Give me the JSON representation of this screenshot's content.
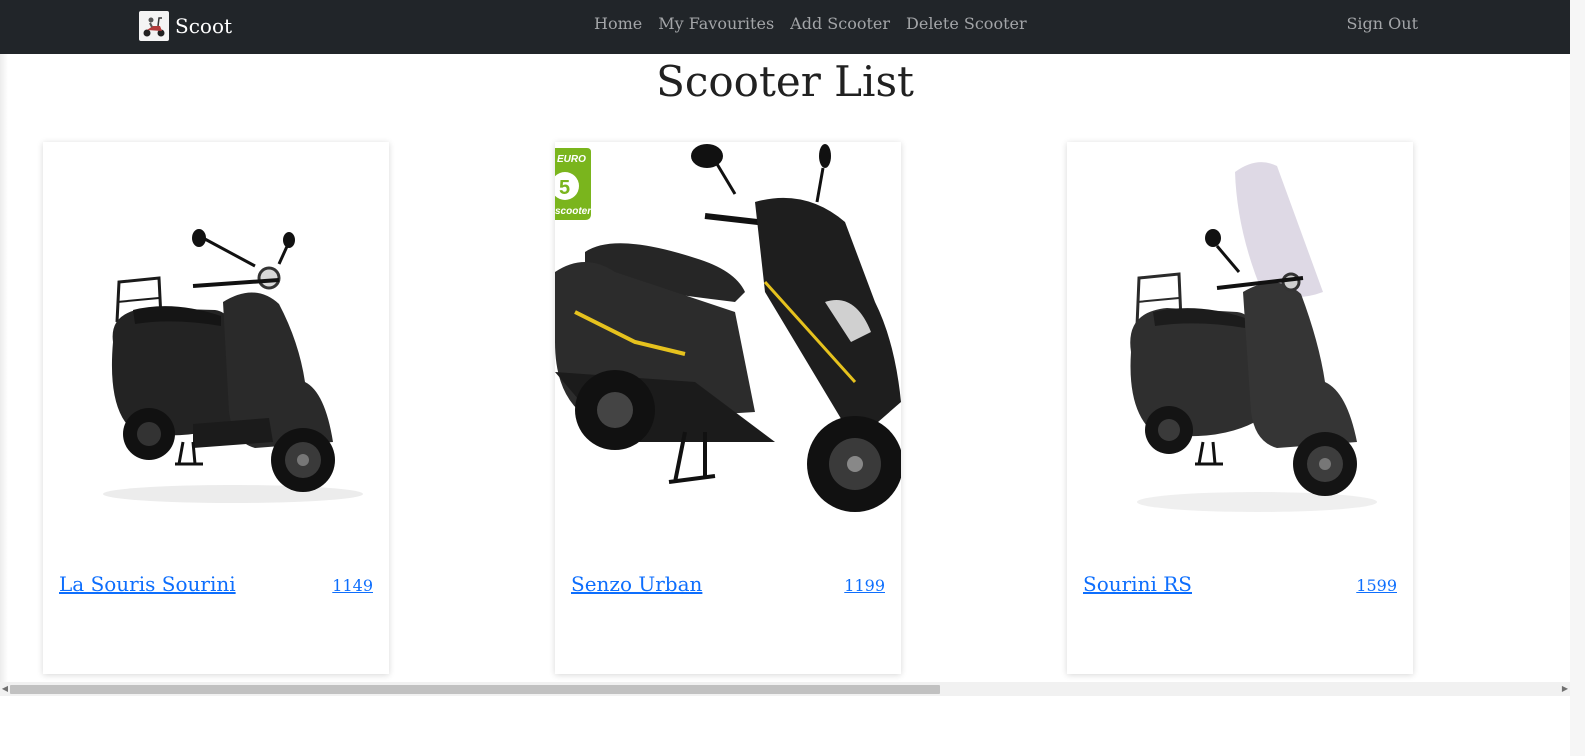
{
  "navbar": {
    "brand": "Scoot",
    "links": [
      "Home",
      "My Favourites",
      "Add Scooter",
      "Delete Scooter"
    ],
    "sign_out": "Sign Out"
  },
  "page": {
    "title": "Scooter List"
  },
  "scooters": [
    {
      "name": "La Souris Sourini",
      "price": "1149",
      "image": "retro-scooter-with-rear-rack"
    },
    {
      "name": "Senzo Urban",
      "price": "1199",
      "image": "sport-scooter-with-euro5-badge"
    },
    {
      "name": "Sourini RS",
      "price": "1599",
      "image": "retro-scooter-with-windshield"
    }
  ],
  "badge": {
    "top": "EURO",
    "number": "5",
    "bottom": "scooter"
  },
  "scrollbar": {
    "left_arrow": "◀",
    "right_arrow": "▶"
  },
  "colors": {
    "navbar": "#212529",
    "link": "#0d6efd",
    "nav_text": "#a3a5a8"
  }
}
